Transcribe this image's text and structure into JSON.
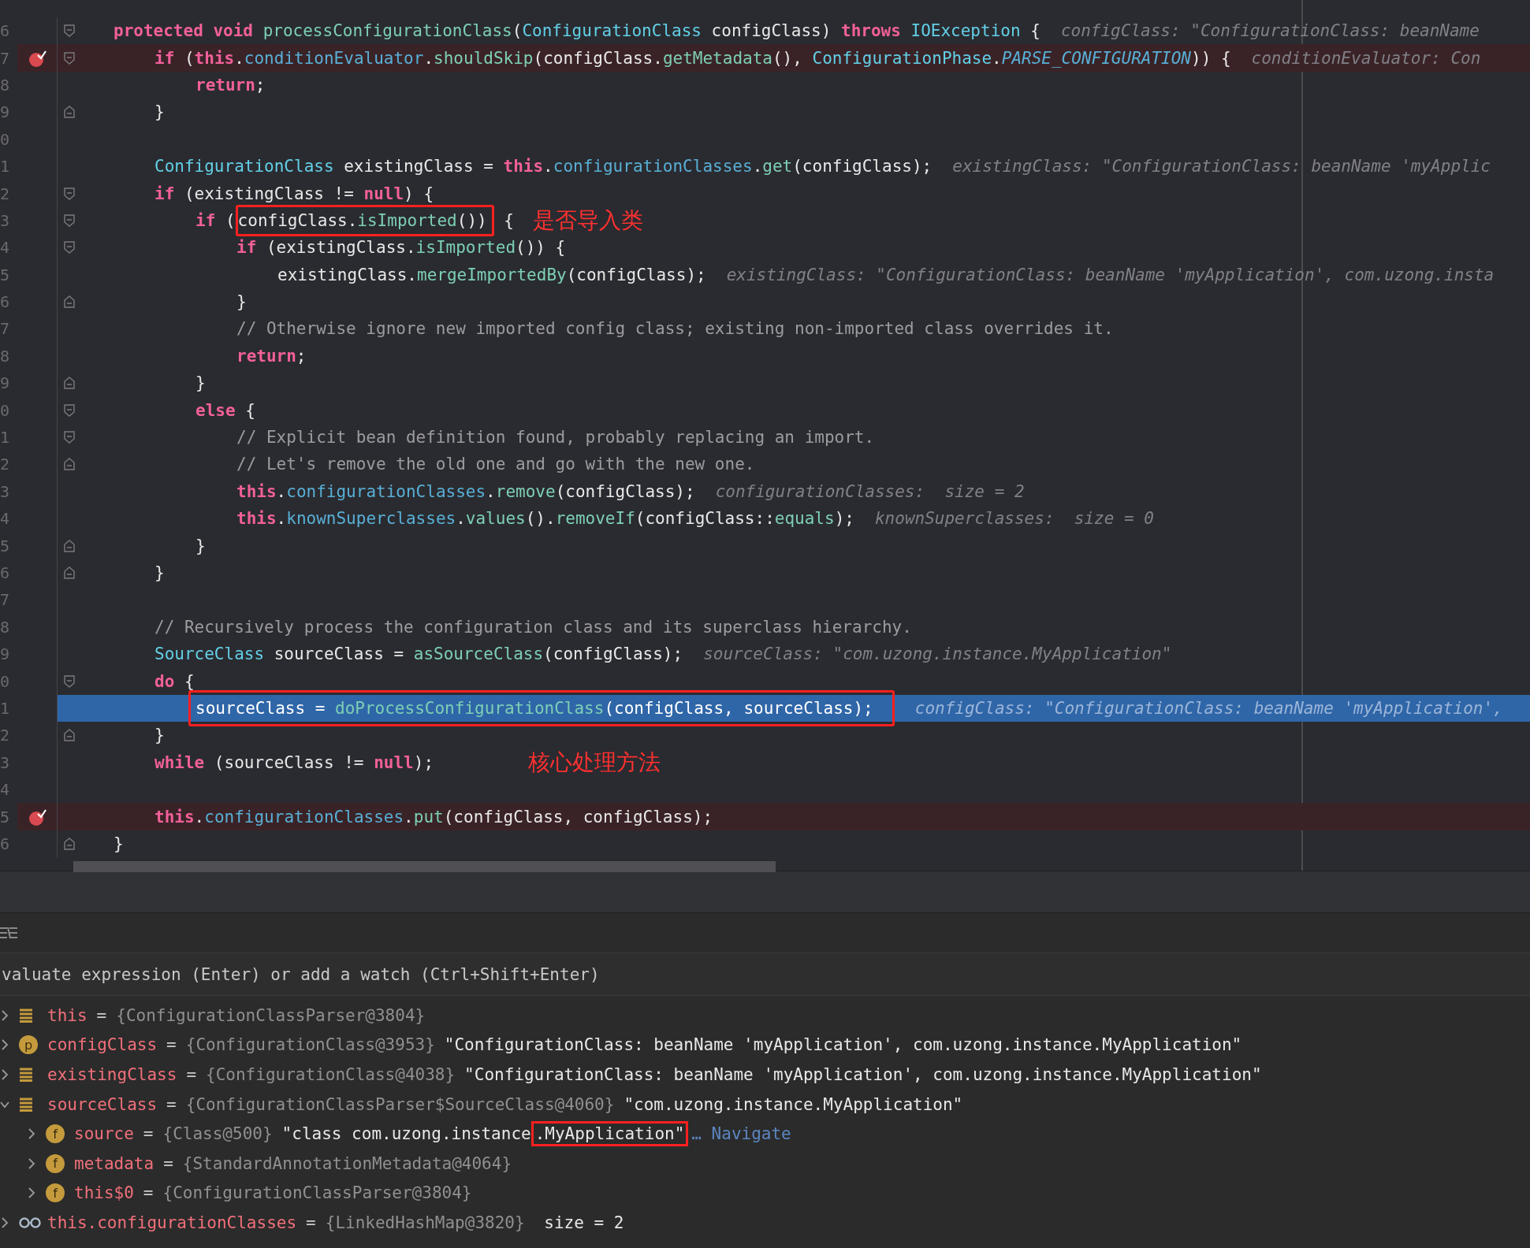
{
  "editor": {
    "lines": [
      {
        "number": "6",
        "breakpoint": false,
        "current": false,
        "fold_start": true,
        "tokens": [
          {
            "kind": "kw",
            "text": "protected void "
          },
          {
            "kind": "method",
            "text": "processConfigurationClass"
          },
          {
            "kind": "plain",
            "text": "("
          },
          {
            "kind": "type",
            "text": "ConfigurationClass"
          },
          {
            "kind": "plain",
            "text": " configClass) "
          },
          {
            "kind": "kw",
            "text": "throws "
          },
          {
            "kind": "type",
            "text": "IOException"
          },
          {
            "kind": "plain",
            "text": " {"
          }
        ],
        "hint": "configClass: \"ConfigurationClass: beanName",
        "children": [
          {
            "number": "7",
            "breakpoint": true,
            "current": false,
            "fold_start": true,
            "tokens": [
              {
                "kind": "kw",
                "text": "if"
              },
              {
                "kind": "plain",
                "text": " ("
              },
              {
                "kind": "kw",
                "text": "this"
              },
              {
                "kind": "plain",
                "text": "."
              },
              {
                "kind": "field",
                "text": "conditionEvaluator"
              },
              {
                "kind": "plain",
                "text": "."
              },
              {
                "kind": "method",
                "text": "shouldSkip"
              },
              {
                "kind": "plain",
                "text": "(configClass."
              },
              {
                "kind": "method",
                "text": "getMetadata"
              },
              {
                "kind": "plain",
                "text": "(), "
              },
              {
                "kind": "type",
                "text": "ConfigurationPhase"
              },
              {
                "kind": "plain",
                "text": "."
              },
              {
                "kind": "const",
                "text": "PARSE_CONFIGURATION"
              },
              {
                "kind": "plain",
                "text": ")) {"
              }
            ],
            "hint": "conditionEvaluator: Con",
            "children": [
              {
                "number": "8",
                "breakpoint": false,
                "current": false,
                "tokens": [
                  {
                    "kind": "kw",
                    "text": "return"
                  },
                  {
                    "kind": "plain",
                    "text": ";"
                  }
                ]
              }
            ]
          },
          {
            "number": "9",
            "breakpoint": false,
            "current": false,
            "fold_end": true,
            "tokens": [
              {
                "kind": "plain",
                "text": "}"
              }
            ]
          },
          {
            "number": "0",
            "breakpoint": false,
            "current": false
          },
          {
            "number": "1",
            "breakpoint": false,
            "current": false,
            "tokens": [
              {
                "kind": "type",
                "text": "ConfigurationClass"
              },
              {
                "kind": "plain",
                "text": " existingClass = "
              },
              {
                "kind": "kw",
                "text": "this"
              },
              {
                "kind": "plain",
                "text": "."
              },
              {
                "kind": "field",
                "text": "configurationClasses"
              },
              {
                "kind": "plain",
                "text": "."
              },
              {
                "kind": "method",
                "text": "get"
              },
              {
                "kind": "plain",
                "text": "(configClass);"
              }
            ],
            "hint": "existingClass: \"ConfigurationClass: beanName 'myApplic"
          },
          {
            "number": "2",
            "breakpoint": false,
            "current": false,
            "fold_start": true,
            "tokens": [
              {
                "kind": "kw",
                "text": "if"
              },
              {
                "kind": "plain",
                "text": " (existingClass != "
              },
              {
                "kind": "kw",
                "text": "null"
              },
              {
                "kind": "plain",
                "text": ") {"
              }
            ],
            "children": [
              {
                "number": "3",
                "breakpoint": false,
                "current": false,
                "fold_start": true,
                "tokens": [
                  {
                    "kind": "kw",
                    "text": "if"
                  },
                  {
                    "kind": "plain",
                    "text": " ("
                  },
                  {
                    "kind": "plain",
                    "text": "configClass.",
                    "box": true
                  },
                  {
                    "kind": "method",
                    "text": "isImported",
                    "box": true
                  },
                  {
                    "kind": "plain",
                    "text": "())",
                    "box": true
                  },
                  {
                    "kind": "plain",
                    "text": " {"
                  }
                ],
                "note": "是否导入类",
                "children": [
                  {
                    "number": "4",
                    "breakpoint": false,
                    "current": false,
                    "fold_start": true,
                    "tokens": [
                      {
                        "kind": "kw",
                        "text": "if"
                      },
                      {
                        "kind": "plain",
                        "text": " (existingClass."
                      },
                      {
                        "kind": "method",
                        "text": "isImported"
                      },
                      {
                        "kind": "plain",
                        "text": "()) {"
                      }
                    ],
                    "children": [
                      {
                        "number": "5",
                        "breakpoint": false,
                        "current": false,
                        "tokens": [
                          {
                            "kind": "plain",
                            "text": "existingClass."
                          },
                          {
                            "kind": "method",
                            "text": "mergeImportedBy"
                          },
                          {
                            "kind": "plain",
                            "text": "(configClass);"
                          }
                        ],
                        "hint": "existingClass: \"ConfigurationClass: beanName 'myApplication', com.uzong.insta"
                      }
                    ]
                  },
                  {
                    "number": "6",
                    "breakpoint": false,
                    "current": false,
                    "fold_end": true,
                    "tokens": [
                      {
                        "kind": "plain",
                        "text": "}"
                      }
                    ]
                  },
                  {
                    "number": "7",
                    "breakpoint": false,
                    "current": false,
                    "tokens": [
                      {
                        "kind": "comment",
                        "text": "// Otherwise ignore new imported config class; existing non-imported class overrides it."
                      }
                    ]
                  },
                  {
                    "number": "8",
                    "breakpoint": false,
                    "current": false,
                    "tokens": [
                      {
                        "kind": "kw",
                        "text": "return"
                      },
                      {
                        "kind": "plain",
                        "text": ";"
                      }
                    ]
                  }
                ]
              },
              {
                "number": "9",
                "breakpoint": false,
                "current": false,
                "fold_end": true,
                "tokens": [
                  {
                    "kind": "plain",
                    "text": "}"
                  }
                ]
              },
              {
                "number": "0",
                "breakpoint": false,
                "current": false,
                "fold_start": true,
                "tokens": [
                  {
                    "kind": "kw",
                    "text": "else"
                  },
                  {
                    "kind": "plain",
                    "text": " {"
                  }
                ],
                "children": [
                  {
                    "number": "1",
                    "breakpoint": false,
                    "current": false,
                    "fold_start": true,
                    "tokens": [
                      {
                        "kind": "comment",
                        "text": "// Explicit bean definition found, probably replacing an import."
                      }
                    ]
                  },
                  {
                    "number": "2",
                    "breakpoint": false,
                    "current": false,
                    "fold_end": true,
                    "tokens": [
                      {
                        "kind": "comment",
                        "text": "// Let's remove the old one and go with the new one."
                      }
                    ]
                  },
                  {
                    "number": "3",
                    "breakpoint": false,
                    "current": false,
                    "tokens": [
                      {
                        "kind": "kw",
                        "text": "this"
                      },
                      {
                        "kind": "plain",
                        "text": "."
                      },
                      {
                        "kind": "field",
                        "text": "configurationClasses"
                      },
                      {
                        "kind": "plain",
                        "text": "."
                      },
                      {
                        "kind": "method",
                        "text": "remove"
                      },
                      {
                        "kind": "plain",
                        "text": "(configClass);"
                      }
                    ],
                    "hint": "configurationClasses:  size = 2"
                  },
                  {
                    "number": "4",
                    "breakpoint": false,
                    "current": false,
                    "tokens": [
                      {
                        "kind": "kw",
                        "text": "this"
                      },
                      {
                        "kind": "plain",
                        "text": "."
                      },
                      {
                        "kind": "field",
                        "text": "knownSuperclasses"
                      },
                      {
                        "kind": "plain",
                        "text": "."
                      },
                      {
                        "kind": "method",
                        "text": "values"
                      },
                      {
                        "kind": "plain",
                        "text": "()."
                      },
                      {
                        "kind": "method",
                        "text": "removeIf"
                      },
                      {
                        "kind": "plain",
                        "text": "(configClass::"
                      },
                      {
                        "kind": "method",
                        "text": "equals"
                      },
                      {
                        "kind": "plain",
                        "text": ");"
                      }
                    ],
                    "hint": "knownSuperclasses:  size = 0"
                  }
                ]
              },
              {
                "number": "5",
                "breakpoint": false,
                "current": false,
                "fold_end": true,
                "tokens": [
                  {
                    "kind": "plain",
                    "text": "}"
                  }
                ]
              }
            ]
          },
          {
            "number": "6",
            "breakpoint": false,
            "current": false,
            "fold_end": true,
            "tokens": [
              {
                "kind": "plain",
                "text": "}"
              }
            ]
          },
          {
            "number": "7",
            "breakpoint": false,
            "current": false
          },
          {
            "number": "8",
            "breakpoint": false,
            "current": false,
            "tokens": [
              {
                "kind": "comment",
                "text": "// Recursively process the configuration class and its superclass hierarchy."
              }
            ]
          },
          {
            "number": "9",
            "breakpoint": false,
            "current": false,
            "tokens": [
              {
                "kind": "type",
                "text": "SourceClass"
              },
              {
                "kind": "plain",
                "text": " sourceClass = "
              },
              {
                "kind": "method",
                "text": "asSourceClass"
              },
              {
                "kind": "plain",
                "text": "(configClass);"
              }
            ],
            "hint": "sourceClass: \"com.uzong.instance.MyApplication\""
          },
          {
            "number": "0",
            "breakpoint": false,
            "current": false,
            "fold_start": true,
            "tokens": [
              {
                "kind": "kw",
                "text": "do"
              },
              {
                "kind": "plain",
                "text": " {"
              }
            ],
            "children": [
              {
                "number": "1",
                "breakpoint": false,
                "current": true,
                "tokens": [
                  {
                    "kind": "plain",
                    "text": "sourceClass = ",
                    "box": true
                  },
                  {
                    "kind": "method",
                    "text": "doProcessConfigurationClass",
                    "box": true
                  },
                  {
                    "kind": "plain",
                    "text": "(configClass, sourceClass);",
                    "box": true
                  }
                ],
                "hint": "configClass: \"ConfigurationClass: beanName 'myApplication',"
              }
            ]
          },
          {
            "number": "2",
            "breakpoint": false,
            "current": false,
            "fold_end": true,
            "tokens": [
              {
                "kind": "plain",
                "text": "}"
              }
            ]
          },
          {
            "number": "3",
            "breakpoint": false,
            "current": false,
            "tokens": [
              {
                "kind": "kw",
                "text": "while"
              },
              {
                "kind": "plain",
                "text": " (sourceClass != "
              },
              {
                "kind": "kw",
                "text": "null"
              },
              {
                "kind": "plain",
                "text": ");"
              }
            ],
            "note": "核心处理方法"
          },
          {
            "number": "4",
            "breakpoint": false,
            "current": false
          },
          {
            "number": "5",
            "breakpoint": true,
            "current": false,
            "tokens": [
              {
                "kind": "kw",
                "text": "this"
              },
              {
                "kind": "plain",
                "text": "."
              },
              {
                "kind": "field",
                "text": "configurationClasses"
              },
              {
                "kind": "plain",
                "text": "."
              },
              {
                "kind": "method",
                "text": "put"
              },
              {
                "kind": "plain",
                "text": "(configClass, configClass);"
              }
            ]
          }
        ]
      },
      {
        "number": "6",
        "breakpoint": false,
        "current": false,
        "fold_end": true,
        "tokens": [
          {
            "kind": "plain",
            "text": "}"
          }
        ]
      }
    ]
  },
  "debugger": {
    "evaluate": {
      "placeholder": "valuate expression (Enter) or add a watch (Ctrl+Shift+Enter)"
    },
    "variables": [
      {
        "kind": "object",
        "expanded": false,
        "name": "this",
        "equals": "=",
        "ref": "{ConfigurationClassParser@3804}"
      },
      {
        "kind": "badge",
        "badge": "p",
        "expanded": false,
        "name": "configClass",
        "equals": "=",
        "ref": "{ConfigurationClass@3953}",
        "value": [
          {
            "text": "\"ConfigurationClass: beanName 'myApplication', com.uzong.instance.MyApplication\"",
            "box": false
          }
        ]
      },
      {
        "kind": "object",
        "expanded": false,
        "name": "existingClass",
        "equals": "=",
        "ref": "{ConfigurationClass@4038}",
        "value": [
          {
            "text": "\"ConfigurationClass: beanName 'myApplication', com.uzong.instance.MyApplication\"",
            "box": false
          }
        ]
      },
      {
        "kind": "object",
        "expanded": true,
        "name": "sourceClass",
        "equals": "=",
        "ref": "{ConfigurationClassParser$SourceClass@4060}",
        "value": [
          {
            "text": "\"com.uzong.instance.MyApplication\"",
            "box": false
          }
        ],
        "children": [
          {
            "kind": "badge",
            "badge": "f",
            "expanded": false,
            "name": "source",
            "equals": "=",
            "ref": "{Class@500}",
            "value": [
              {
                "text": "\"class com.uzong.instance",
                "box": false
              },
              {
                "text": ".MyApplication\"",
                "box": true
              }
            ],
            "link": "… Navigate"
          },
          {
            "kind": "badge",
            "badge": "f",
            "expanded": false,
            "name": "metadata",
            "equals": "=",
            "ref": "{StandardAnnotationMetadata@4064}"
          },
          {
            "kind": "badge",
            "badge": "f",
            "expanded": false,
            "name": "this$0",
            "equals": "=",
            "ref": "{ConfigurationClassParser@3804}"
          }
        ]
      },
      {
        "kind": "watch",
        "expanded": false,
        "name": "this.configurationClasses",
        "equals": "=",
        "ref": "{LinkedHashMap@3820}",
        "value": [
          {
            "text": " size = 2",
            "box": false
          }
        ]
      }
    ]
  }
}
